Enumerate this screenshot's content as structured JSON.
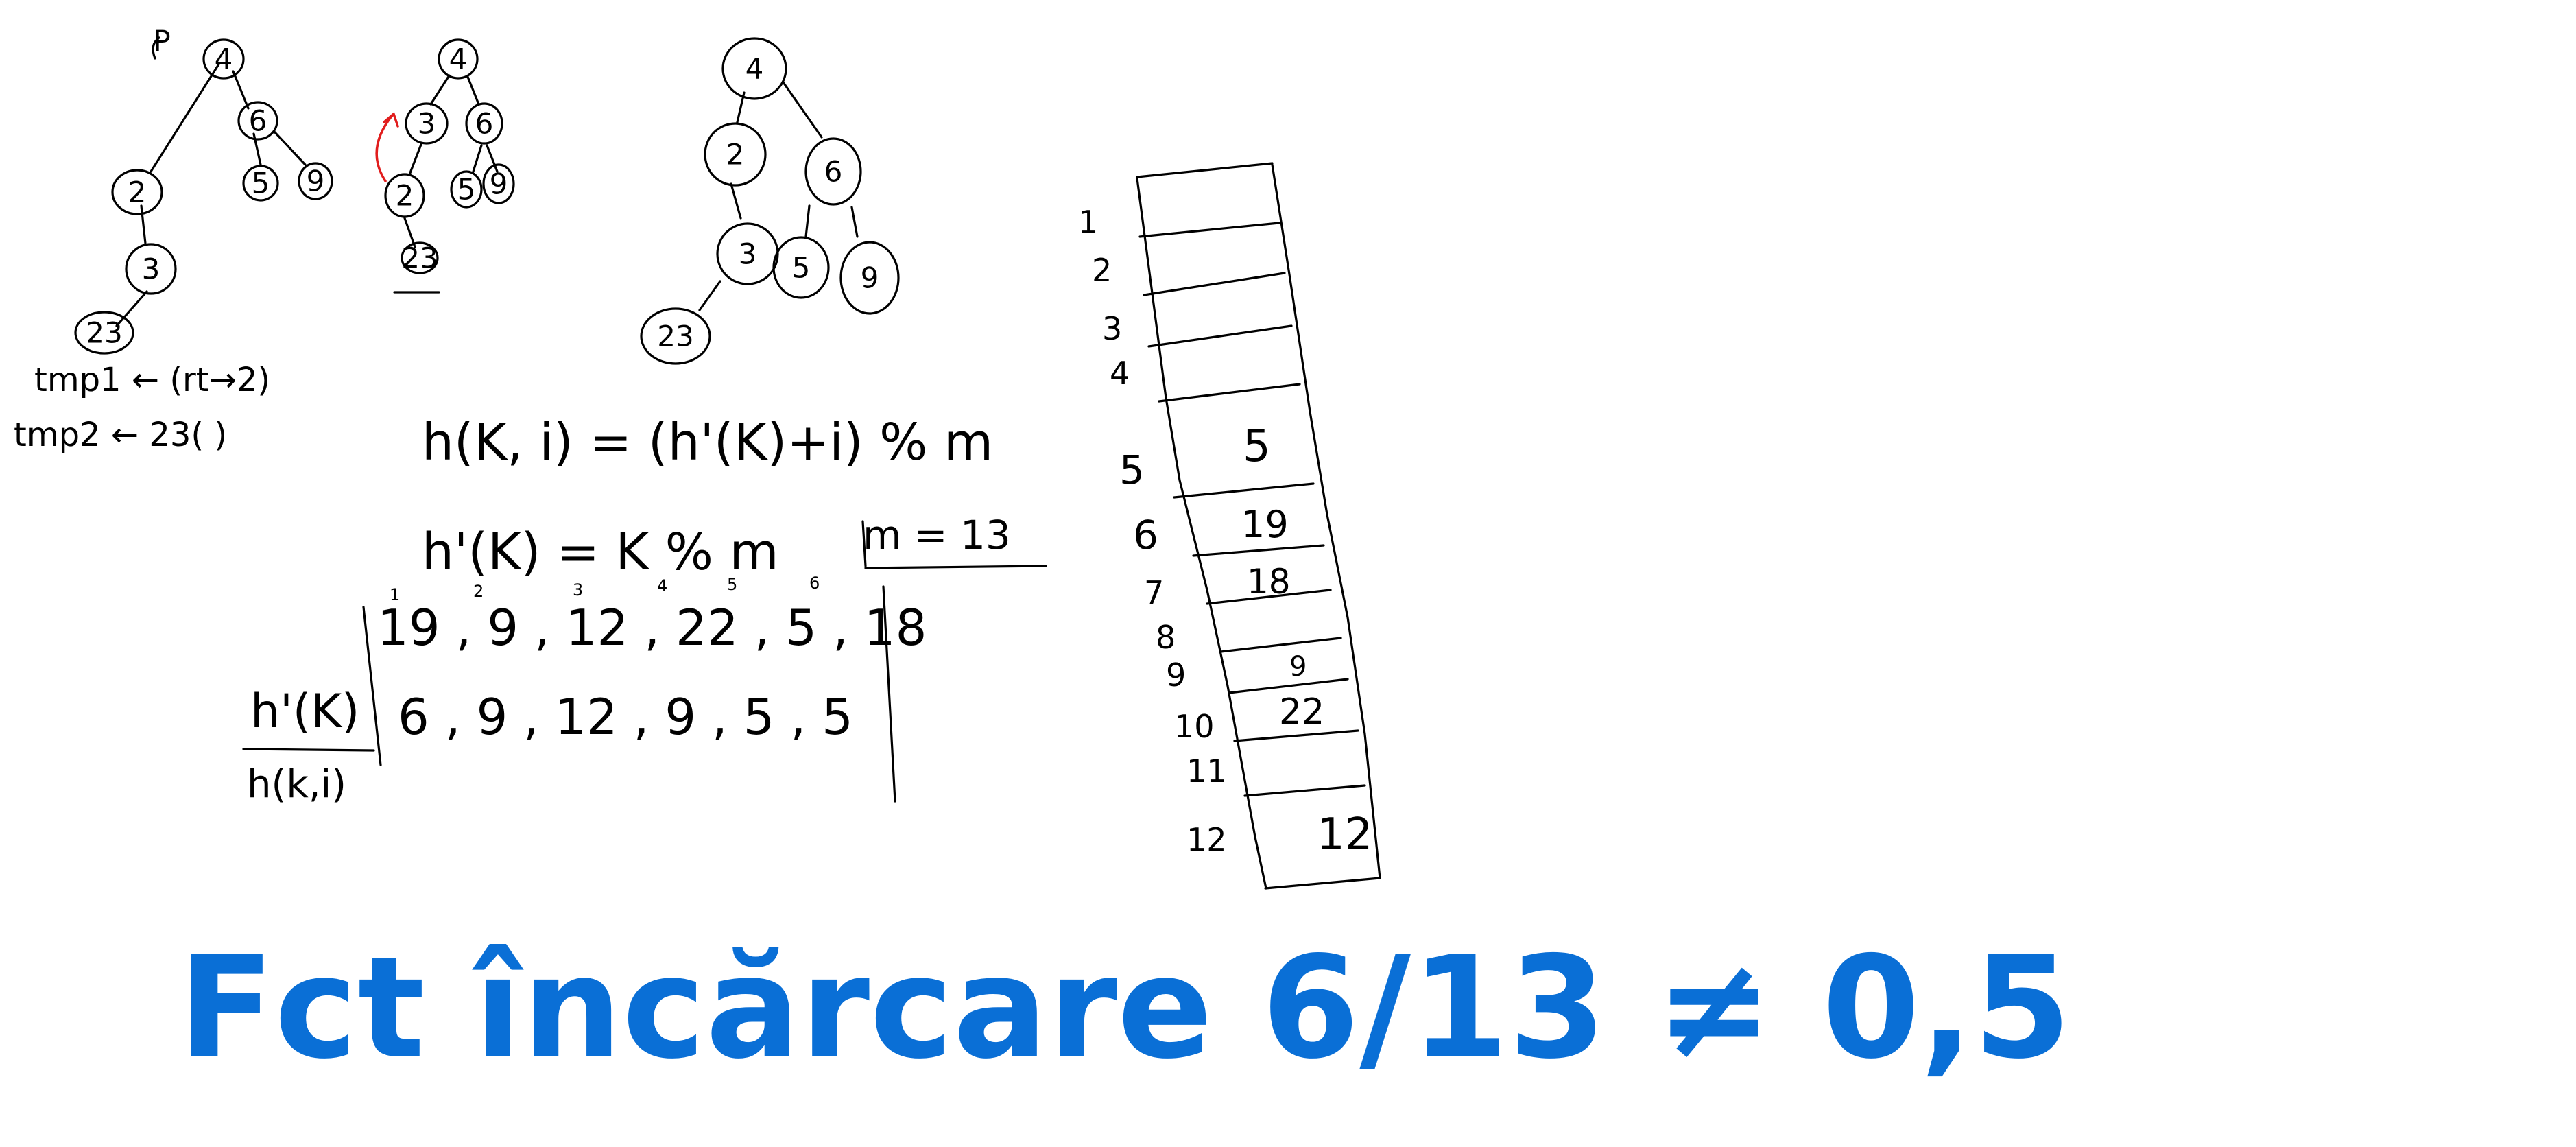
{
  "colors": {
    "ink": "#000000",
    "accent": "#0a6fd6",
    "arrow": "#e11d1d"
  },
  "tree1": {
    "nodes": [
      "4",
      "6",
      "5",
      "9",
      "2",
      "3",
      "23"
    ],
    "note": "P"
  },
  "tree2": {
    "nodes": [
      "4",
      "3",
      "6",
      "2",
      "5",
      "9",
      "23"
    ]
  },
  "tree3": {
    "nodes": [
      "4",
      "2",
      "6",
      "3",
      "5",
      "9",
      "23"
    ]
  },
  "tmp": {
    "line1": "tmp1 ← (rt→2)",
    "line2": "tmp2 ← 23(  )"
  },
  "formulas": {
    "hash": "h(K, i) = (h'(K)+i) % m",
    "hprime": "h'(K) = K % m",
    "m": "m = 13"
  },
  "calc": {
    "indices": [
      "1",
      "2",
      "3",
      "4",
      "5",
      "6"
    ],
    "keys": "19 , 9 , 12 , 22 , 5 , 18",
    "hprime_label": "h'(K)",
    "hk_label": "h(k,i)",
    "hprime_values": "6 , 9 , 12 , 9 , 5 , 5"
  },
  "table": {
    "rows": [
      {
        "index": "1",
        "value": ""
      },
      {
        "index": "2",
        "value": ""
      },
      {
        "index": "3",
        "value": ""
      },
      {
        "index": "4",
        "value": ""
      },
      {
        "index": "5",
        "value": "5"
      },
      {
        "index": "6",
        "value": "19"
      },
      {
        "index": "7",
        "value": "18"
      },
      {
        "index": "8",
        "value": ""
      },
      {
        "index": "9",
        "value": "9"
      },
      {
        "index": "10",
        "value": "22"
      },
      {
        "index": "11",
        "value": ""
      },
      {
        "index": "12",
        "value": "12"
      }
    ]
  },
  "headline": "Fct încărcare 6/13 ≠ 0,5"
}
